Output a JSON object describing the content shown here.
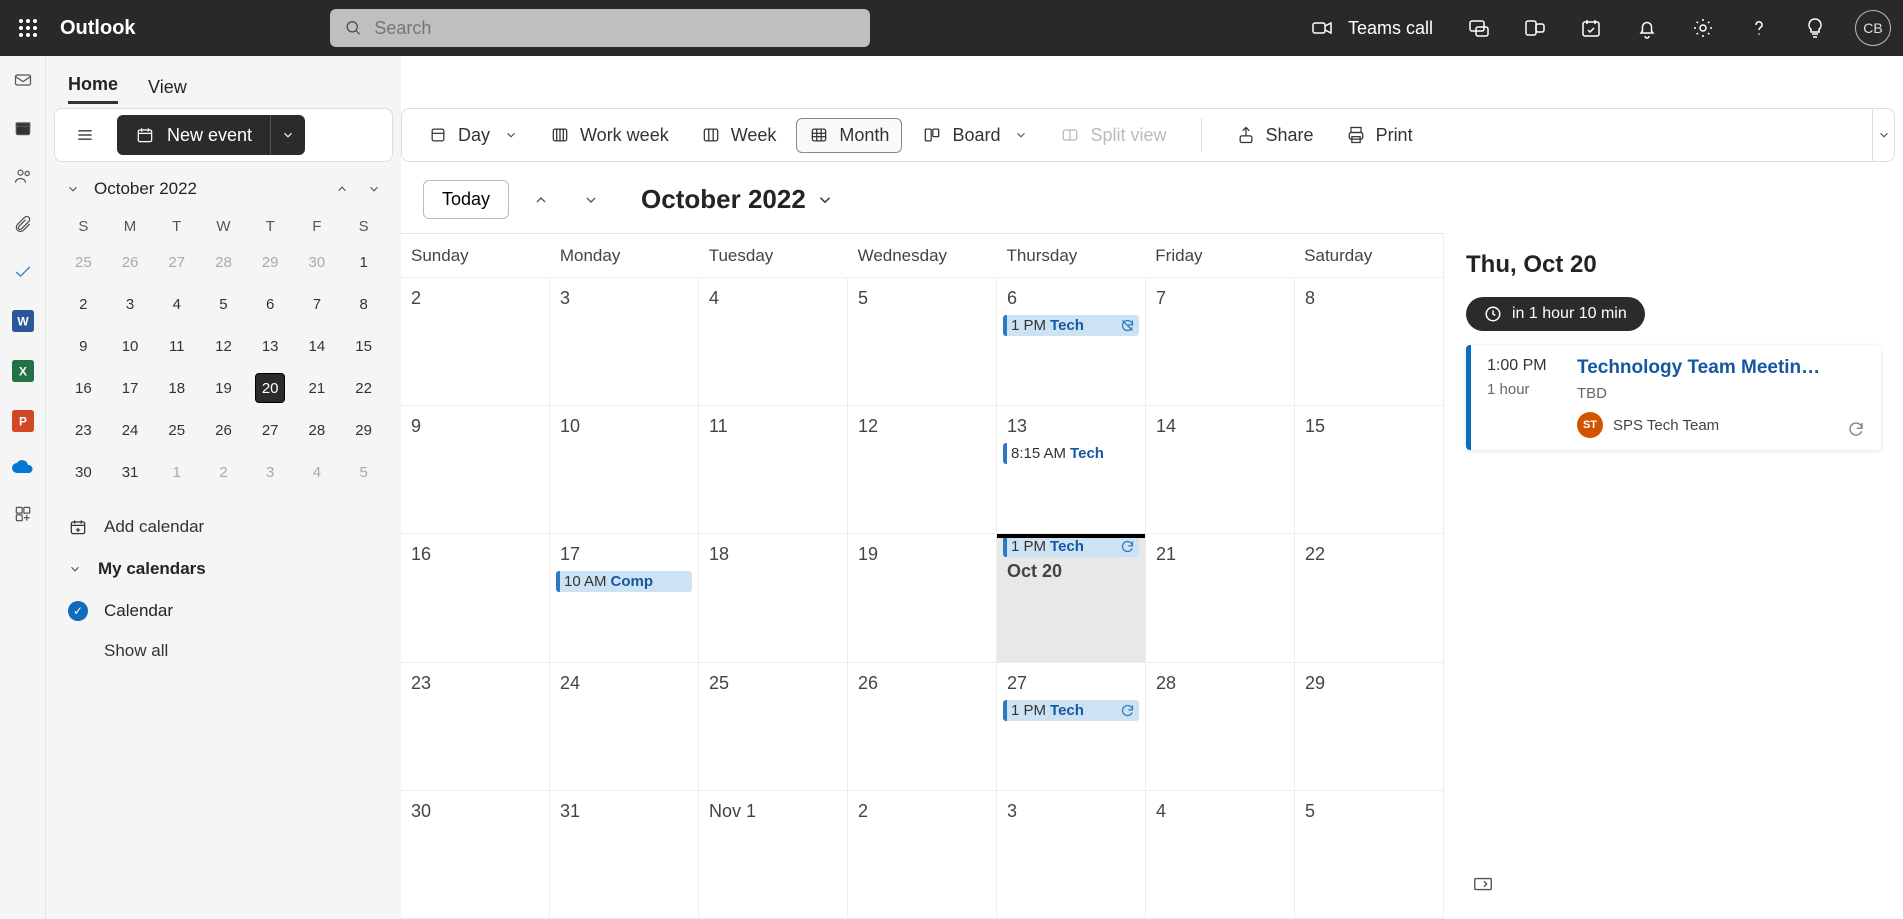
{
  "topbar": {
    "brand": "Outlook",
    "search_placeholder": "Search",
    "teams_call": "Teams call",
    "avatar_initials": "CB"
  },
  "tabs": {
    "home": "Home",
    "view": "View"
  },
  "toolbar": {
    "new_event": "New event",
    "day": "Day",
    "work_week": "Work week",
    "week": "Week",
    "month": "Month",
    "board": "Board",
    "split_view": "Split view",
    "share": "Share",
    "print": "Print"
  },
  "minical": {
    "title": "October 2022",
    "dow": [
      "S",
      "M",
      "T",
      "W",
      "T",
      "F",
      "S"
    ],
    "today_day": 20,
    "rows": [
      [
        {
          "n": 25,
          "dim": true
        },
        {
          "n": 26,
          "dim": true
        },
        {
          "n": 27,
          "dim": true
        },
        {
          "n": 28,
          "dim": true
        },
        {
          "n": 29,
          "dim": true
        },
        {
          "n": 30,
          "dim": true
        },
        {
          "n": 1
        }
      ],
      [
        {
          "n": 2
        },
        {
          "n": 3
        },
        {
          "n": 4
        },
        {
          "n": 5
        },
        {
          "n": 6
        },
        {
          "n": 7
        },
        {
          "n": 8
        }
      ],
      [
        {
          "n": 9
        },
        {
          "n": 10
        },
        {
          "n": 11
        },
        {
          "n": 12
        },
        {
          "n": 13
        },
        {
          "n": 14
        },
        {
          "n": 15
        }
      ],
      [
        {
          "n": 16
        },
        {
          "n": 17
        },
        {
          "n": 18
        },
        {
          "n": 19
        },
        {
          "n": 20
        },
        {
          "n": 21
        },
        {
          "n": 22
        }
      ],
      [
        {
          "n": 23
        },
        {
          "n": 24
        },
        {
          "n": 25
        },
        {
          "n": 26
        },
        {
          "n": 27
        },
        {
          "n": 28
        },
        {
          "n": 29
        }
      ],
      [
        {
          "n": 30
        },
        {
          "n": 31
        },
        {
          "n": 1,
          "dim": true
        },
        {
          "n": 2,
          "dim": true
        },
        {
          "n": 3,
          "dim": true
        },
        {
          "n": 4,
          "dim": true
        },
        {
          "n": 5,
          "dim": true
        }
      ]
    ]
  },
  "sidepanel": {
    "add_calendar": "Add calendar",
    "my_calendars": "My calendars",
    "calendar_item": "Calendar",
    "show_all": "Show all"
  },
  "calhdr": {
    "today_btn": "Today",
    "month_title": "October 2022"
  },
  "dow_full": [
    "Sunday",
    "Monday",
    "Tuesday",
    "Wednesday",
    "Thursday",
    "Friday",
    "Saturday"
  ],
  "weeks": [
    [
      {
        "label": "2"
      },
      {
        "label": "3"
      },
      {
        "label": "4"
      },
      {
        "label": "5"
      },
      {
        "label": "6",
        "events": [
          {
            "time": "1 PM",
            "title": "Tech",
            "icon": "no-recur"
          }
        ]
      },
      {
        "label": "7"
      },
      {
        "label": "8"
      }
    ],
    [
      {
        "label": "9"
      },
      {
        "label": "10"
      },
      {
        "label": "11"
      },
      {
        "label": "12"
      },
      {
        "label": "13",
        "events": [
          {
            "time": "8:15 AM",
            "title": "Tech",
            "plain": true
          }
        ]
      },
      {
        "label": "14"
      },
      {
        "label": "15"
      }
    ],
    [
      {
        "label": "16"
      },
      {
        "label": "17",
        "events": [
          {
            "time": "10 AM",
            "title": "Comp"
          }
        ]
      },
      {
        "label": "18"
      },
      {
        "label": "19"
      },
      {
        "label": "Oct 20",
        "today": true,
        "mark": true,
        "events": [
          {
            "time": "1 PM",
            "title": "Tech",
            "icon": "recur",
            "above": true
          }
        ]
      },
      {
        "label": "21"
      },
      {
        "label": "22"
      }
    ],
    [
      {
        "label": "23"
      },
      {
        "label": "24"
      },
      {
        "label": "25"
      },
      {
        "label": "26"
      },
      {
        "label": "27",
        "events": [
          {
            "time": "1 PM",
            "title": "Tech",
            "icon": "recur"
          }
        ]
      },
      {
        "label": "28"
      },
      {
        "label": "29"
      }
    ],
    [
      {
        "label": "30"
      },
      {
        "label": "31"
      },
      {
        "label": "Nov 1"
      },
      {
        "label": "2"
      },
      {
        "label": "3"
      },
      {
        "label": "4"
      },
      {
        "label": "5"
      }
    ]
  ],
  "agenda": {
    "date_label": "Thu, Oct 20",
    "countdown": "in 1 hour 10 min",
    "event": {
      "start": "1:00 PM",
      "duration": "1 hour",
      "title": "Technology Team Meetin…",
      "location": "TBD",
      "organizer_initials": "ST",
      "organizer_name": "SPS Tech Team"
    }
  }
}
